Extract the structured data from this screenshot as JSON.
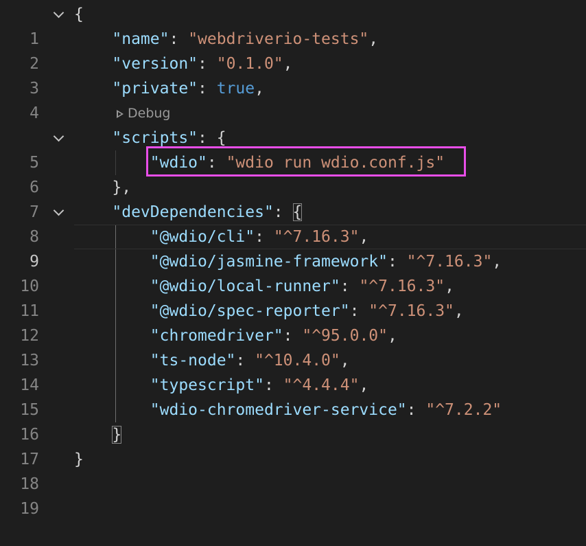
{
  "editor": {
    "language": "json",
    "active_line": 9,
    "codelens": {
      "label": "Debug",
      "icon": "play-outline-icon"
    },
    "lines": {
      "l1": {
        "num": "1",
        "t1": "{"
      },
      "l2": {
        "num": "2",
        "key": "\"name\"",
        "colon": ": ",
        "val": "\"webdriverio-tests\"",
        "end": ","
      },
      "l3": {
        "num": "3",
        "key": "\"version\"",
        "colon": ": ",
        "val": "\"0.1.0\"",
        "end": ","
      },
      "l4": {
        "num": "4",
        "key": "\"private\"",
        "colon": ": ",
        "val": "true",
        "end": ","
      },
      "l5": {
        "num": "5",
        "key": "\"scripts\"",
        "colon": ": ",
        "end": "{"
      },
      "l6": {
        "num": "6",
        "key": "\"wdio\"",
        "colon": ": ",
        "val": "\"wdio run wdio.conf.js\""
      },
      "l7": {
        "num": "7",
        "t1": "},"
      },
      "l8": {
        "num": "8",
        "key": "\"devDependencies\"",
        "colon": ": ",
        "end": "{"
      },
      "l9": {
        "num": "9",
        "key": "\"@wdio/cli\"",
        "colon": ": ",
        "val": "\"^7.16.3\"",
        "end": ","
      },
      "l10": {
        "num": "10",
        "key": "\"@wdio/jasmine-framework\"",
        "colon": ": ",
        "val": "\"^7.16.3\"",
        "end": ","
      },
      "l11": {
        "num": "11",
        "key": "\"@wdio/local-runner\"",
        "colon": ": ",
        "val": "\"^7.16.3\"",
        "end": ","
      },
      "l12": {
        "num": "12",
        "key": "\"@wdio/spec-reporter\"",
        "colon": ": ",
        "val": "\"^7.16.3\"",
        "end": ","
      },
      "l13": {
        "num": "13",
        "key": "\"chromedriver\"",
        "colon": ": ",
        "val": "\"^95.0.0\"",
        "end": ","
      },
      "l14": {
        "num": "14",
        "key": "\"ts-node\"",
        "colon": ": ",
        "val": "\"^10.4.0\"",
        "end": ","
      },
      "l15": {
        "num": "15",
        "key": "\"typescript\"",
        "colon": ": ",
        "val": "\"^4.4.4\"",
        "end": ","
      },
      "l16": {
        "num": "16",
        "key": "\"wdio-chromedriver-service\"",
        "colon": ": ",
        "val": "\"^7.2.2\""
      },
      "l17": {
        "num": "17",
        "t1": "}"
      },
      "l18": {
        "num": "18",
        "t1": "}"
      },
      "l19": {
        "num": "19"
      }
    }
  },
  "colors": {
    "background": "#1e1e1e",
    "key": "#9cdcfe",
    "string": "#ce9178",
    "boolean": "#569cd6",
    "highlight_box": "#e84ee8"
  }
}
